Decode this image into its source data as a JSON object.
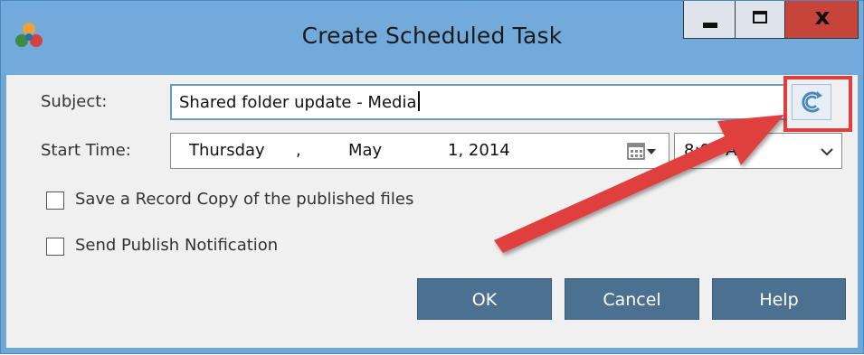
{
  "window": {
    "title": "Create Scheduled Task",
    "minimize_label": "",
    "maximize_label": "",
    "close_label": "x"
  },
  "form": {
    "subject_label": "Subject:",
    "subject_value": "Shared folder update - Media",
    "start_time_label": "Start Time:",
    "date": {
      "day": "Thursday",
      "separator": ",",
      "month": "May",
      "date_year": "1, 2014"
    },
    "time_value": "8:00 AM"
  },
  "options": [
    {
      "label": "Save a Record Copy of the published files",
      "checked": false
    },
    {
      "label": "Send Publish Notification",
      "checked": false
    }
  ],
  "buttons": {
    "ok": "OK",
    "cancel": "Cancel",
    "help": "Help"
  },
  "annotation": {
    "color": "#e0403c"
  },
  "icons": {
    "app": "app-logo-icon",
    "schedule": "recurrence-icon",
    "calendar": "calendar-dropdown-icon",
    "time": "chevron-down-icon"
  }
}
